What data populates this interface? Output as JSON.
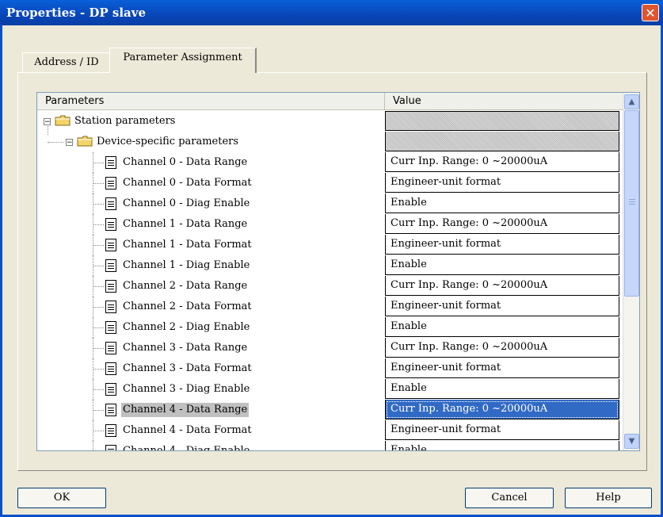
{
  "window": {
    "title": "Properties - DP slave",
    "close_symbol": "✕"
  },
  "tabs": [
    {
      "label": "Address / ID",
      "active": false
    },
    {
      "label": "Parameter Assignment",
      "active": true
    }
  ],
  "grid": {
    "headers": {
      "parameters": "Parameters",
      "value": "Value"
    },
    "groups": [
      {
        "label": "Station parameters",
        "expander": "−",
        "icon": "folder-icon"
      },
      {
        "label": "Device-specific parameters",
        "expander": "−",
        "icon": "folder-icon"
      }
    ],
    "rows": [
      {
        "param": "Channel 0 - Data Range",
        "value": "Curr Inp. Range: 0 ~20000uA"
      },
      {
        "param": "Channel 0 - Data Format",
        "value": "Engineer-unit format"
      },
      {
        "param": "Channel 0 - Diag Enable",
        "value": "Enable"
      },
      {
        "param": "Channel 1 - Data Range",
        "value": "Curr Inp. Range: 0 ~20000uA"
      },
      {
        "param": "Channel 1 - Data Format",
        "value": "Engineer-unit format"
      },
      {
        "param": "Channel 1 - Diag Enable",
        "value": "Enable"
      },
      {
        "param": "Channel 2 - Data Range",
        "value": "Curr Inp. Range: 0 ~20000uA"
      },
      {
        "param": "Channel 2 - Data Format",
        "value": "Engineer-unit format"
      },
      {
        "param": "Channel 2 - Diag Enable",
        "value": "Enable"
      },
      {
        "param": "Channel 3 - Data Range",
        "value": "Curr Inp. Range: 0 ~20000uA"
      },
      {
        "param": "Channel 3 - Data Format",
        "value": "Engineer-unit format"
      },
      {
        "param": "Channel 3 - Diag Enable",
        "value": "Enable"
      },
      {
        "param": "Channel 4 - Data Range",
        "value": "Curr Inp. Range: 0 ~20000uA",
        "selected": true
      },
      {
        "param": "Channel 4 - Data Format",
        "value": "Engineer-unit format"
      },
      {
        "param": "Channel 4 - Diag Enable",
        "value": "Enable"
      }
    ],
    "scroll_up_symbol": "▲",
    "scroll_down_symbol": "▼"
  },
  "buttons": {
    "ok": "OK",
    "cancel": "Cancel",
    "help": "Help"
  },
  "colors": {
    "titlebar": "#0A50C8",
    "selection": "#316AC5",
    "dialog_bg": "#ECE9D8"
  }
}
